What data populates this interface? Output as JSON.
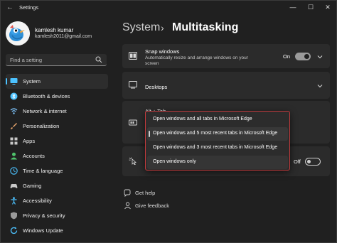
{
  "window": {
    "title": "Settings",
    "back_glyph": "←",
    "controls": {
      "minimize": "—",
      "maximize": "☐",
      "close": "✕"
    }
  },
  "user": {
    "name": "kamlesh kumar",
    "email": "kamlesh2011@gmail.com"
  },
  "search": {
    "placeholder": "Find a setting"
  },
  "sidebar": {
    "items": [
      {
        "label": "System",
        "icon": "monitor-icon",
        "color": "#4cc2ff",
        "active": true
      },
      {
        "label": "Bluetooth & devices",
        "icon": "bluetooth-icon",
        "color": "#4cc2ff"
      },
      {
        "label": "Network & internet",
        "icon": "wifi-icon",
        "color": "#7fc6ff"
      },
      {
        "label": "Personalization",
        "icon": "brush-icon",
        "color": "#e6a36c"
      },
      {
        "label": "Apps",
        "icon": "apps-icon",
        "color": "#c9c9c9"
      },
      {
        "label": "Accounts",
        "icon": "person-icon",
        "color": "#4fc26b"
      },
      {
        "label": "Time & language",
        "icon": "globe-clock-icon",
        "color": "#4cc2ff"
      },
      {
        "label": "Gaming",
        "icon": "gamepad-icon",
        "color": "#c9c9c9"
      },
      {
        "label": "Accessibility",
        "icon": "accessibility-icon",
        "color": "#4cc2ff"
      },
      {
        "label": "Privacy & security",
        "icon": "shield-icon",
        "color": "#9a9a9a"
      },
      {
        "label": "Windows Update",
        "icon": "update-icon",
        "color": "#4cc2ff"
      }
    ]
  },
  "main": {
    "breadcrumb_root": "System",
    "breadcrumb_sep": "›",
    "title": "Multitasking",
    "snap": {
      "title": "Snap windows",
      "subtitle": "Automatically resize and arrange windows on your screen",
      "state": "On"
    },
    "desktops": {
      "title": "Desktops"
    },
    "alttab": {
      "title": "Alt + Tab"
    },
    "titlebar_shake": {
      "state": "Off"
    },
    "dropdown": {
      "options": [
        "Open windows and all tabs in Microsoft Edge",
        "Open windows and 5 most recent tabs in Microsoft Edge",
        "Open windows and 3 most recent tabs in Microsoft Edge",
        "Open windows only"
      ],
      "selected_index": 1
    },
    "links": [
      {
        "label": "Get help",
        "icon": "help-icon"
      },
      {
        "label": "Give feedback",
        "icon": "feedback-icon"
      }
    ]
  }
}
